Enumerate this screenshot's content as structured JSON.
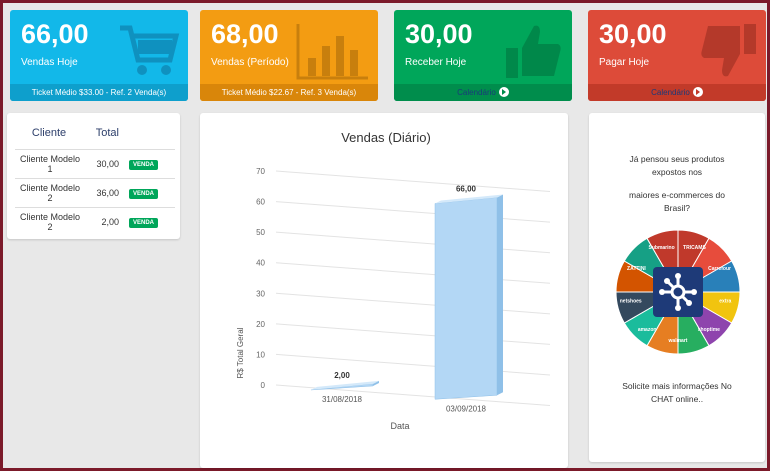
{
  "cards": [
    {
      "value": "66,00",
      "label": "Vendas Hoje",
      "footer": "Ticket Médio $33.00 - Ref. 2 Venda(s)",
      "icon": "shopping-cart-icon",
      "color": "#12b8e9"
    },
    {
      "value": "68,00",
      "label": "Vendas (Período)",
      "footer": "Ticket Médio $22.67 - Ref. 3 Venda(s)",
      "icon": "bar-chart-icon",
      "color": "#f39c12"
    },
    {
      "value": "30,00",
      "label": "Receber Hoje",
      "footer": "Calendário",
      "icon": "thumbs-up-icon",
      "color": "#00a65a"
    },
    {
      "value": "30,00",
      "label": "Pagar Hoje",
      "footer": "Calendário",
      "icon": "thumbs-down-icon",
      "color": "#dd4b39"
    }
  ],
  "sales_table": {
    "headers": [
      "Cliente",
      "Total"
    ],
    "rows": [
      {
        "client": "Cliente Modelo 1",
        "total": "30,00",
        "action": "VENDA"
      },
      {
        "client": "Cliente Modelo 2",
        "total": "36,00",
        "action": "VENDA"
      },
      {
        "client": "Cliente Modelo 2",
        "total": "2,00",
        "action": "VENDA"
      }
    ]
  },
  "chart_data": {
    "type": "bar",
    "title": "Vendas (Diário)",
    "xlabel": "Data",
    "ylabel": "R$ Total Geral",
    "categories": [
      "31/08/2018",
      "03/09/2018"
    ],
    "values": [
      2,
      66
    ],
    "value_labels": [
      "2,00",
      "66,00"
    ],
    "ylim": [
      0,
      70
    ],
    "yticks": [
      0,
      10,
      20,
      30,
      40,
      50,
      60,
      70
    ],
    "bar_color": "#b3d7f5",
    "grid": true
  },
  "ad": {
    "line1": "Já pensou seus produtos expostos nos",
    "line2": "maiores e-commerces do Brasil?",
    "line3": "Solicite mais informações No CHAT online..",
    "wheel_labels": [
      "TRICAMS",
      "Carrefour",
      "extra",
      "shoptime",
      "walmart",
      "amazon",
      "netshoes",
      "ZATTINI",
      "Submarino"
    ]
  }
}
